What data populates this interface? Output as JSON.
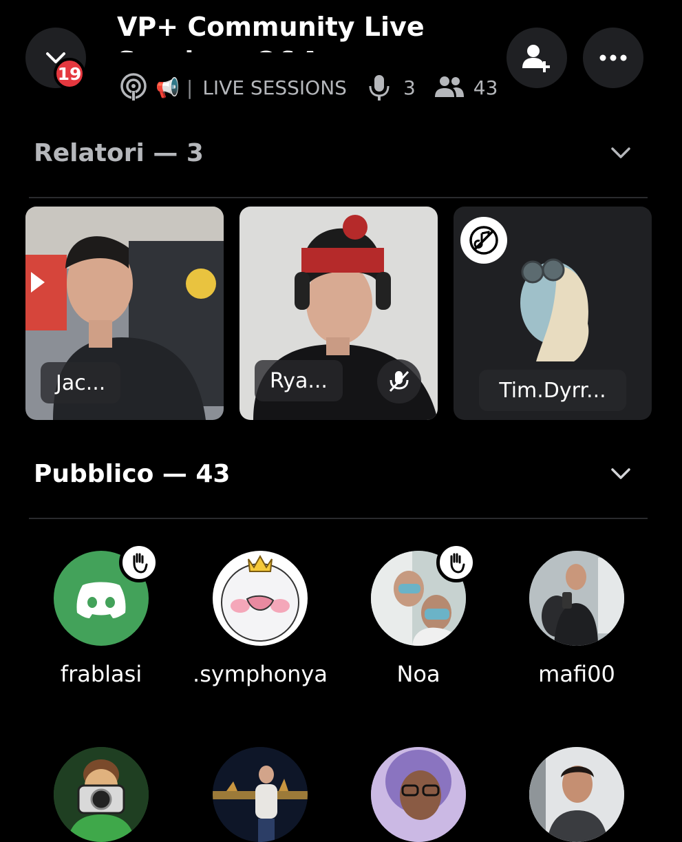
{
  "header": {
    "title": "VP+ Community Live Sessions Q&A",
    "badge_count": "19",
    "megaphone": "📢",
    "separator": "|",
    "category": "LIVE SESSIONS",
    "speaker_count": "3",
    "listener_count": "43"
  },
  "speakers_section": {
    "label": "Relatori — 3",
    "tiles": [
      {
        "name": "Jac..."
      },
      {
        "name": "Rya..."
      },
      {
        "name": "Tim.Dyrr..."
      }
    ]
  },
  "audience_section": {
    "label": "Pubblico — 43",
    "members": [
      {
        "name": "frablasi"
      },
      {
        "name": ".symphonya"
      },
      {
        "name": "Noa"
      },
      {
        "name": "mafi00"
      }
    ]
  },
  "colors": {
    "background": "#000000",
    "button_bg": "#1f2023",
    "badge": "#e5383f",
    "discord_green": "#43a25a",
    "muted_text": "#b5b7bb"
  }
}
